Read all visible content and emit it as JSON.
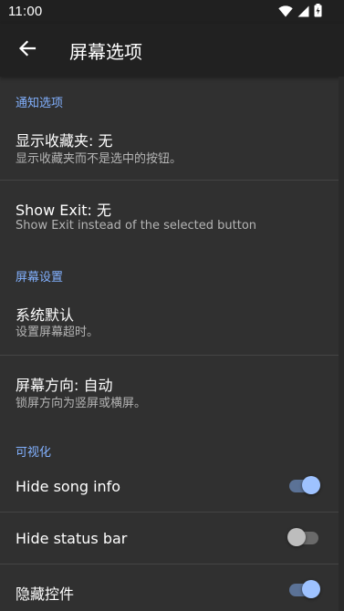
{
  "status_bar": {
    "time": "11:00",
    "icons": [
      "wifi-icon",
      "cell-signal-icon",
      "battery-icon"
    ]
  },
  "app_bar": {
    "back_icon": "arrow-back-icon",
    "title": "屏幕选项"
  },
  "sections": [
    {
      "header": "通知选项",
      "items": [
        {
          "title": "显示收藏夹: 无",
          "summary": "显示收藏夹而不是选中的按钮。"
        },
        {
          "title": "Show Exit: 无",
          "summary": "Show Exit instead of the selected button"
        }
      ]
    },
    {
      "header": "屏幕设置",
      "items": [
        {
          "title": "系统默认",
          "summary": "设置屏幕超时。"
        },
        {
          "title": "屏幕方向: 自动",
          "summary": "锁屏方向为竖屏或横屏。"
        }
      ]
    },
    {
      "header": "可视化",
      "items": [
        {
          "title": "Hide song info",
          "switch_on": true
        },
        {
          "title": "Hide status bar",
          "switch_on": false
        },
        {
          "title": "隐藏控件",
          "switch_on": true
        }
      ]
    }
  ],
  "colors": {
    "accent": "#82b1ff",
    "background": "#303030",
    "app_bar": "#212121",
    "switch_thumb_on": "#9ec2ff"
  }
}
